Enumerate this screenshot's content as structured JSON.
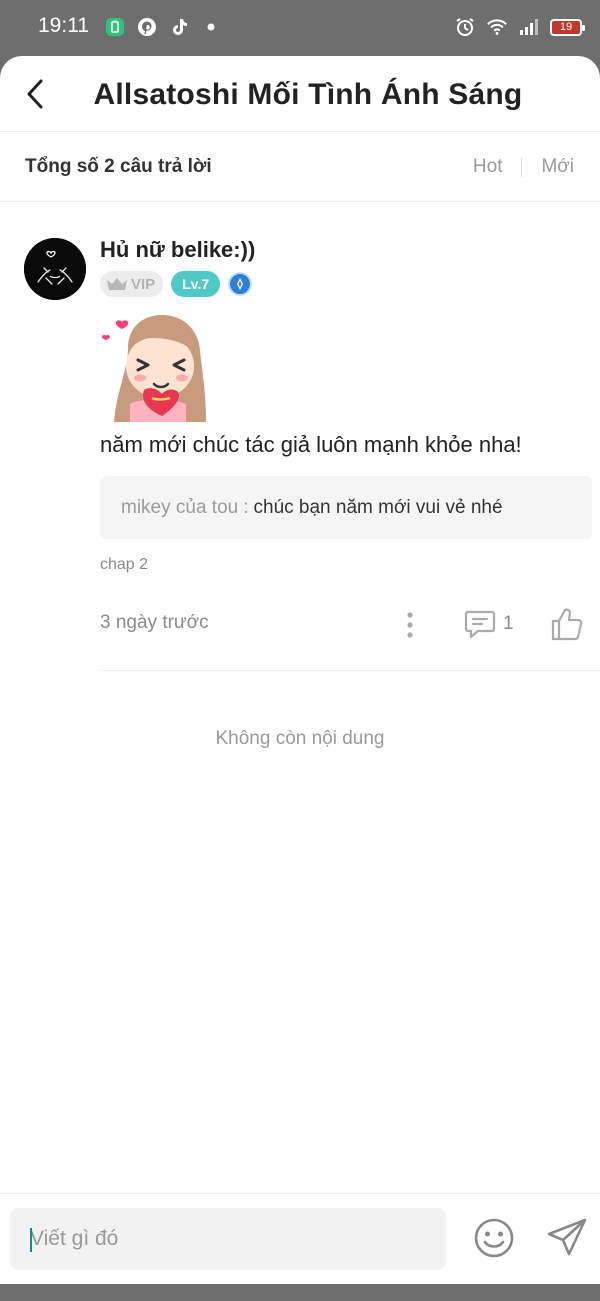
{
  "status_bar": {
    "time": "19:11",
    "battery": "19",
    "left_icons": [
      "battery-saver-icon",
      "pinterest-icon",
      "tiktok-icon",
      "notification-dot-icon"
    ],
    "right_icons": [
      "alarm-icon",
      "wifi-icon",
      "signal-icon",
      "battery-icon"
    ]
  },
  "header": {
    "title": "Allsatoshi Mối Tình Ánh Sáng",
    "back_icon": "chevron-left-icon"
  },
  "summary": {
    "count_text": "Tổng số 2 câu trả lời",
    "sort_tabs": [
      "Hot",
      "Mới"
    ]
  },
  "comment": {
    "username": "Hủ nữ belike:))",
    "vip_label": "VIP",
    "level_label": "Lv.7",
    "text": "năm mới chúc tác giả luôn mạnh khỏe nha!",
    "reply": {
      "author": "mikey của tou",
      "separator": ":",
      "text": "chúc bạn năm mới vui vẻ nhé"
    },
    "chapter": "chap 2",
    "time_ago": "3 ngày trước",
    "reply_count": "1"
  },
  "end_text": "Không còn nội dung",
  "input": {
    "placeholder": "Viết gì đó"
  },
  "colors": {
    "level_badge": "#4fc9c6",
    "vip_badge": "#ececec",
    "medal": "#2f7fd4",
    "caret": "#1a8c7e"
  }
}
